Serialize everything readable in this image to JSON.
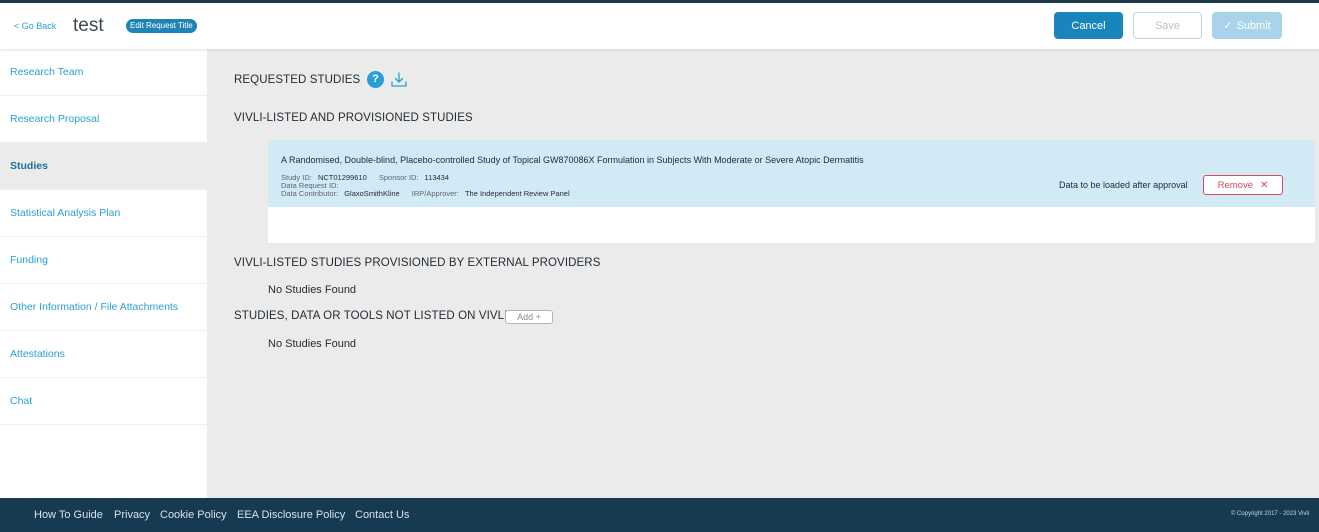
{
  "header": {
    "go_back": "< Go Back",
    "title": "test",
    "edit_title": "Edit Request Title",
    "cancel": "Cancel",
    "save": "Save",
    "submit": "Submit"
  },
  "sidebar": {
    "items": [
      {
        "label": "Research Team"
      },
      {
        "label": "Research Proposal"
      },
      {
        "label": "Studies",
        "active": true
      },
      {
        "label": "Statistical Analysis Plan"
      },
      {
        "label": "Funding"
      },
      {
        "label": "Other Information / File Attachments"
      },
      {
        "label": "Attestations"
      },
      {
        "label": "Chat"
      }
    ]
  },
  "main": {
    "requested_heading": "REQUESTED STUDIES",
    "help_icon_text": "?",
    "provisioned_heading": "VIVLI-LISTED AND PROVISIONED STUDIES",
    "study": {
      "title": "A Randomised, Double-blind, Placebo-controlled Study of Topical GW870086X Formulation in Subjects With Moderate or Severe Atopic Dermatitis",
      "study_id_label": "Study ID:",
      "study_id": "NCT01299610",
      "sponsor_id_label": "Sponsor ID:",
      "sponsor_id": "113434",
      "data_request_id_label": "Data Request ID:",
      "data_contributor_label": "Data Contributor:",
      "data_contributor": "GlaxoSmithKline",
      "irp_label": "IRP/Approver:",
      "irp": "The Independent Review Panel",
      "status": "Data to be loaded after approval",
      "remove": "Remove"
    },
    "external_heading": "VIVLI-LISTED STUDIES PROVISIONED BY EXTERNAL PROVIDERS",
    "external_empty": "No Studies Found",
    "not_listed_heading": "STUDIES, DATA OR TOOLS NOT LISTED ON VIVLI",
    "add": "Add +",
    "not_listed_empty": "No Studies Found"
  },
  "footer": {
    "links": [
      "How To Guide",
      "Privacy",
      "Cookie Policy",
      "EEA Disclosure Policy",
      "Contact Us"
    ],
    "copyright": "© Copyright 2017 - 2023 Vivli"
  },
  "colors": {
    "accent": "#2a9fd6",
    "primary_button": "#1a84bd",
    "footer": "#153a52",
    "study_highlight": "#d2eaf6",
    "remove": "#d9485f"
  },
  "icons": {
    "help": "help-icon",
    "download": "download-icon",
    "submit_check": "check-icon",
    "remove_close": "close-icon"
  }
}
